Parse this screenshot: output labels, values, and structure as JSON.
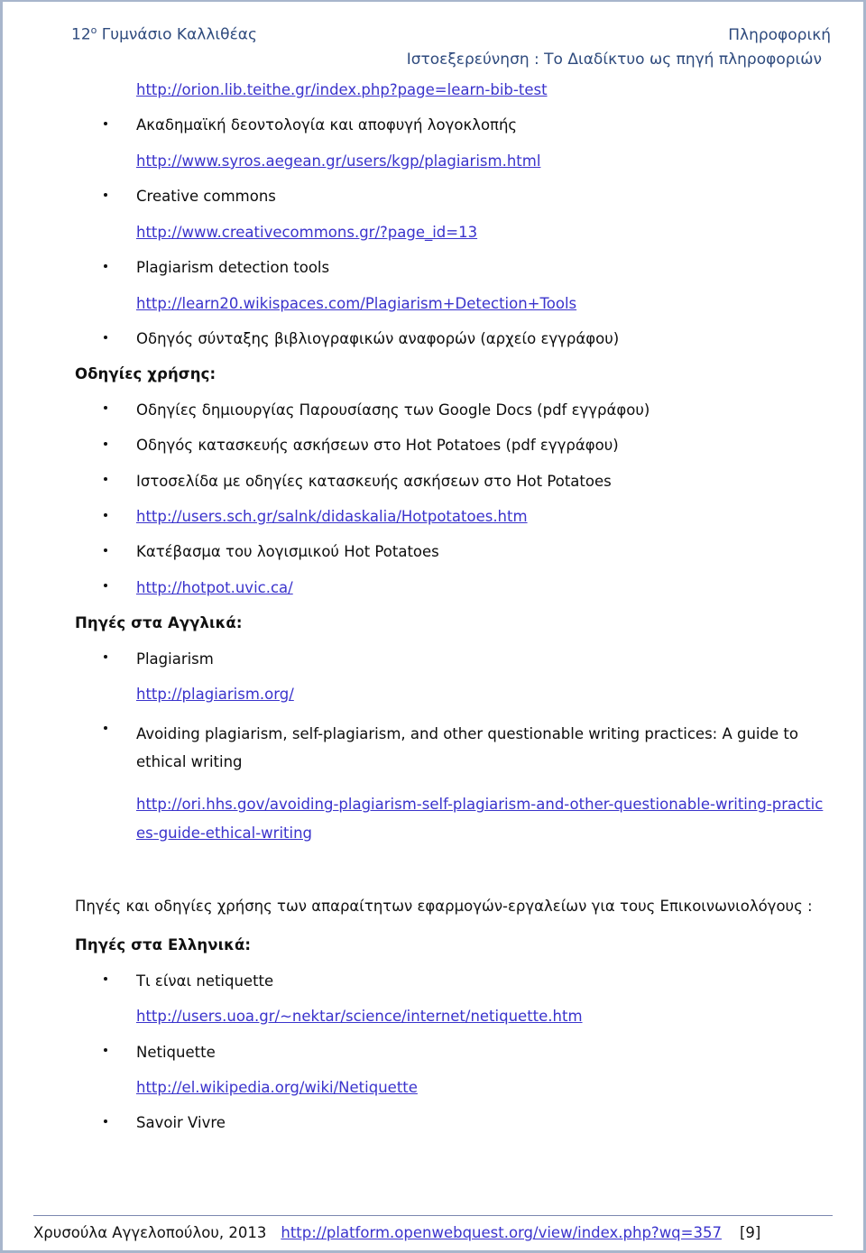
{
  "header": {
    "school": "12",
    "school_sup": "ο",
    "school_rest": " Γυμνάσιο Καλλιθέας",
    "subject": "Πληροφορική",
    "subtitle": "Ιστοεξερεύνηση : Το Διαδίκτυο ως πηγή πληροφοριών"
  },
  "content": {
    "url_orion": "http://orion.lib.teithe.gr/index.php?page=learn-bib-test",
    "item_academic_ethics": "Ακαδημαϊκή δεοντολογία και αποφυγή λογοκλοπής",
    "url_syros": "http://www.syros.aegean.gr/users/kgp/plagiarism.html",
    "item_creative_commons": "Creative commons",
    "url_creativecommons": "http://www.creativecommons.gr/?page_id=13",
    "item_plagiarism_tools": "Plagiarism detection tools",
    "url_learn20": "http://learn20.wikispaces.com/Plagiarism+Detection+Tools",
    "item_bib_guide": "Οδηγός σύνταξης βιβλιογραφικών αναφορών (αρχείο εγγράφου)",
    "heading_usage": "Οδηγίες χρήσης:",
    "item_google_docs": "Οδηγίες δημιουργίας Παρουσίασης των Google Docs (pdf εγγράφου)",
    "item_hotpotatoes_guide": "Οδηγός κατασκευής ασκήσεων στο Hot Potatoes (pdf εγγράφου)",
    "item_hotpotatoes_site": "Ιστοσελίδα με οδηγίες κατασκευής ασκήσεων στο Hot Potatoes",
    "url_users_sch": "http://users.sch.gr/salnk/didaskalia/Hotpotatoes.htm",
    "item_hotpotatoes_download": "Κατέβασμα του λογισμικού Hot Potatoes",
    "url_hotpot": "http://hotpot.uvic.ca/",
    "heading_english_sources": "Πηγές στα Αγγλικά:",
    "item_plagiarism": "Plagiarism",
    "url_plagiarism_org": "http://plagiarism.org/",
    "item_avoiding_plagiarism": "Avoiding plagiarism, self-plagiarism, and other questionable writing practices: A guide to ethical writing",
    "url_ori_hhs": "http://ori.hhs.gov/avoiding-plagiarism-self-plagiarism-and-other-questionable-writing-practices-guide-ethical-writing",
    "para_tools": "Πηγές και οδηγίες χρήσης των απαραίτητων εφαρμογών-εργαλείων για τους Επικοινωνιολόγους :",
    "heading_greek_sources": "Πηγές στα Ελληνικά:",
    "item_what_is_netiquette": "Τι είναι netiquette",
    "url_users_uoa": "http://users.uoa.gr/~nektar/science/internet/netiquette.htm",
    "item_netiquette": "Netiquette",
    "url_el_wikipedia": "http://el.wikipedia.org/wiki/Netiquette",
    "item_savoir_vivre": "Savoir Vivre"
  },
  "footer": {
    "author": "Χρυσούλα Αγγελοπούλου, 2013",
    "url": "http://platform.openwebquest.org/view/index.php?wq=357",
    "page": "[9]"
  },
  "colors": {
    "header_blue": "#2e4a7d",
    "link_blue": "#3a33cc",
    "page_border": "#a8b6cc",
    "footer_rule": "#7b88b0"
  }
}
